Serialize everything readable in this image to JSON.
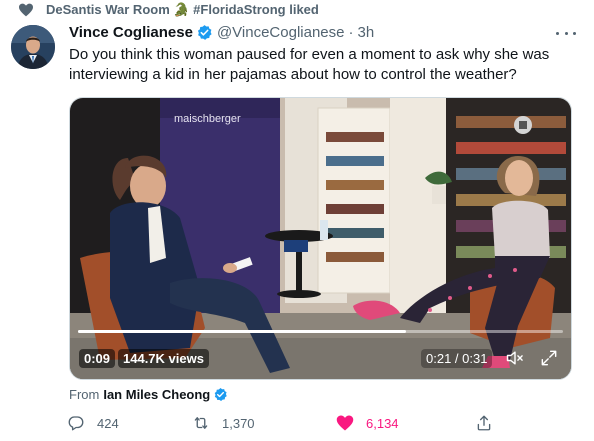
{
  "social_context": {
    "text": "DeSantis War Room 🐊 #FloridaStrong liked"
  },
  "tweet": {
    "author_name": "Vince Coglianese",
    "handle": "@VinceCoglianese",
    "separator": "·",
    "time": "3h",
    "text": "Do you think this woman paused for even a moment to ask why she was interviewing a kid in her pajamas about how to control the weather?"
  },
  "media": {
    "backdrop_text": "maischberger",
    "elapsed": "0:09",
    "views": "144.7K views",
    "time_display": "0:21 / 0:31",
    "progress": 0.677
  },
  "source": {
    "from_label": "From",
    "name": "Ian Miles Cheong"
  },
  "actions": {
    "replies": "424",
    "retweets": "1,370",
    "likes": "6,134"
  },
  "colors": {
    "accent": "#1d9bf0",
    "like": "#f91880",
    "muted": "#536471"
  }
}
